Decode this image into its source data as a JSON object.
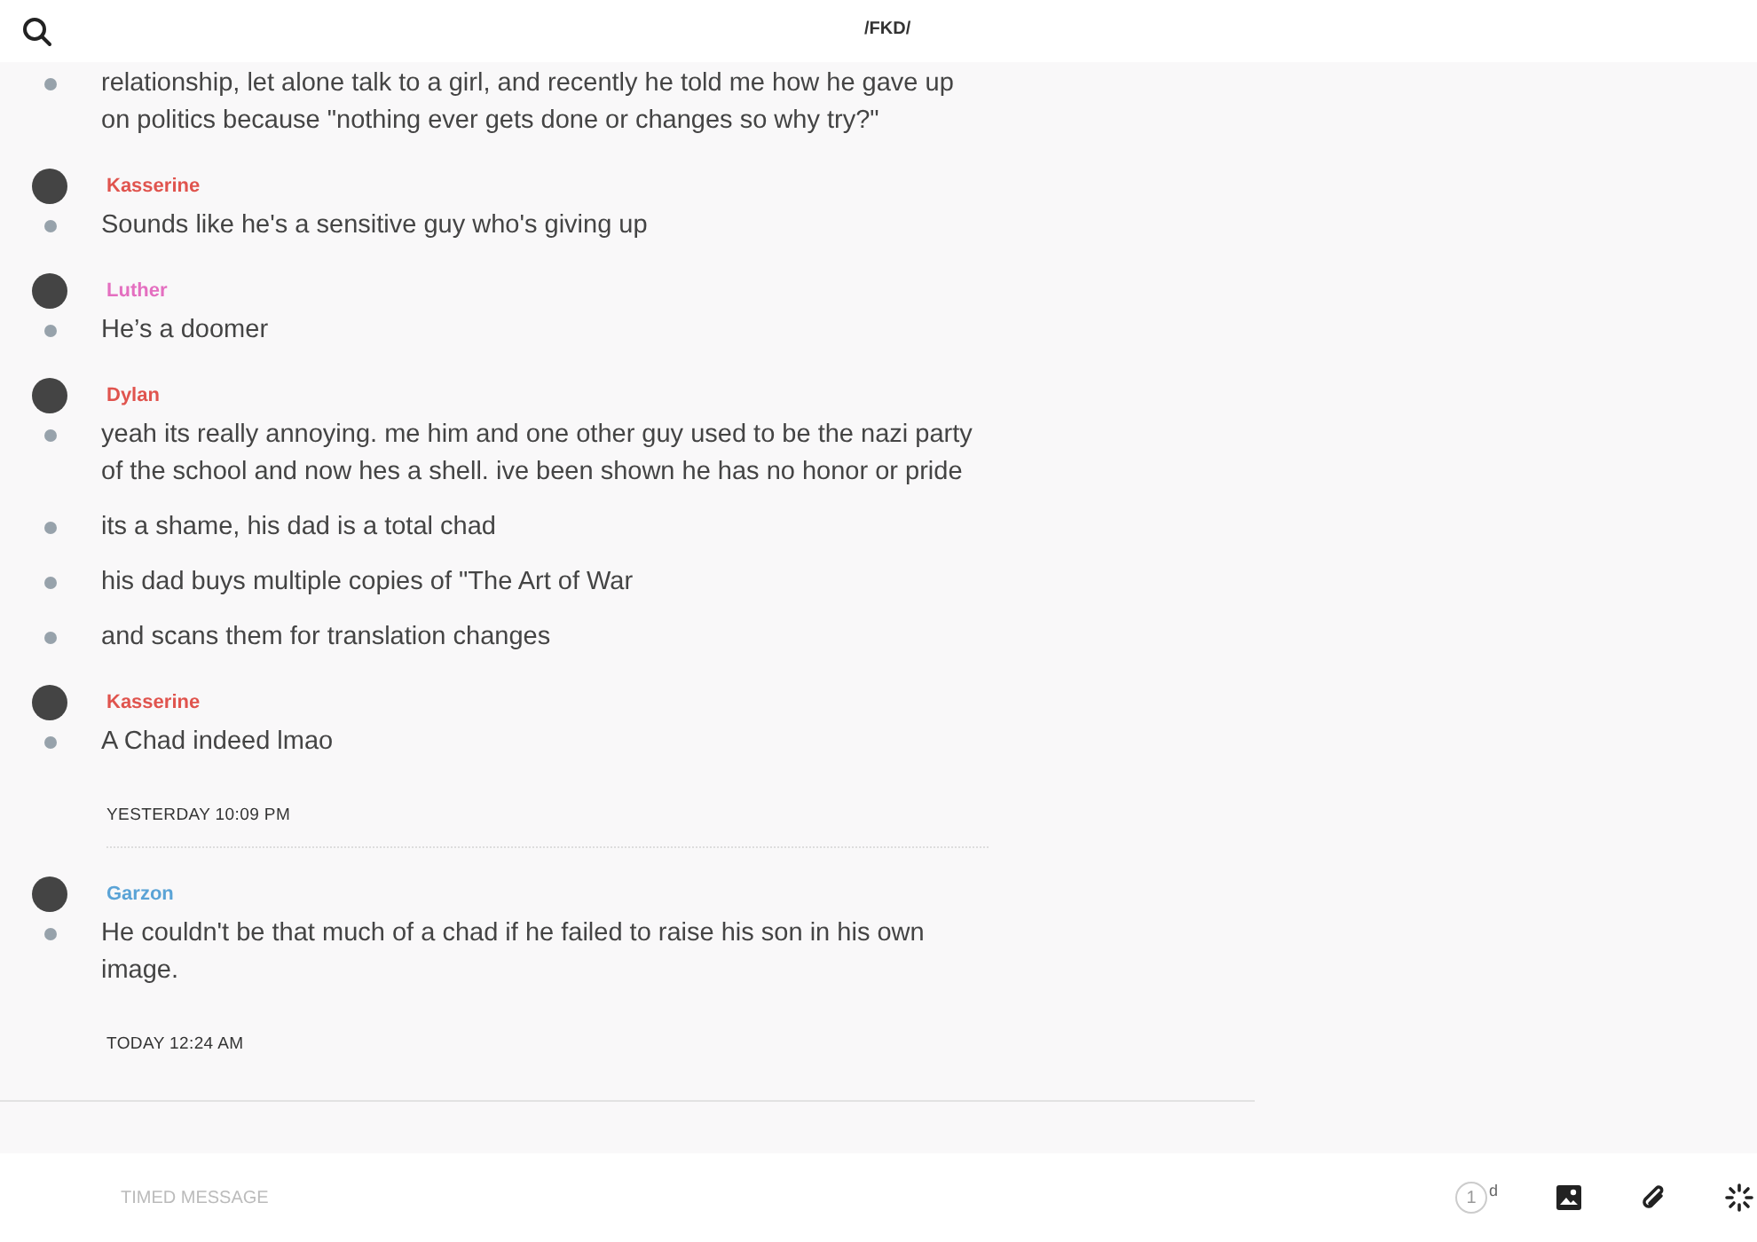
{
  "header": {
    "title": "/FKD/"
  },
  "messages": [
    {
      "kind": "message",
      "lines": [
        "relationship, let alone talk to a girl, and recently he told me how he gave up on politics because \"nothing ever gets done or changes so why try?\""
      ]
    },
    {
      "kind": "message",
      "author": "Kasserine",
      "color": "#e0544e",
      "lines": [
        "Sounds like he's a sensitive guy who's giving up"
      ]
    },
    {
      "kind": "message",
      "author": "Luther",
      "color": "#e46fc0",
      "lines": [
        "He’s a doomer"
      ]
    },
    {
      "kind": "message",
      "author": "Dylan",
      "color": "#e0544e",
      "lines": [
        "yeah its really annoying. me him and one other guy used to be the nazi party of the school and now hes a shell. ive been shown he has no honor or pride",
        "its a shame, his dad is a total chad",
        "his dad buys multiple copies of \"The Art of War",
        "and scans them for translation changes"
      ]
    },
    {
      "kind": "message",
      "author": "Kasserine",
      "color": "#e0544e",
      "lines": [
        "A Chad indeed lmao"
      ]
    },
    {
      "kind": "divider",
      "label": "YESTERDAY 10:09 PM"
    },
    {
      "kind": "message",
      "author": "Garzon",
      "color": "#5aa3d6",
      "lines": [
        "He couldn't be that much of a chad if he failed to raise his son in his own image."
      ]
    },
    {
      "kind": "divider",
      "label": "TODAY 12:24 AM"
    }
  ],
  "composer": {
    "placeholder": "TIMED MESSAGE",
    "timer": "1",
    "timer_unit": "d"
  }
}
